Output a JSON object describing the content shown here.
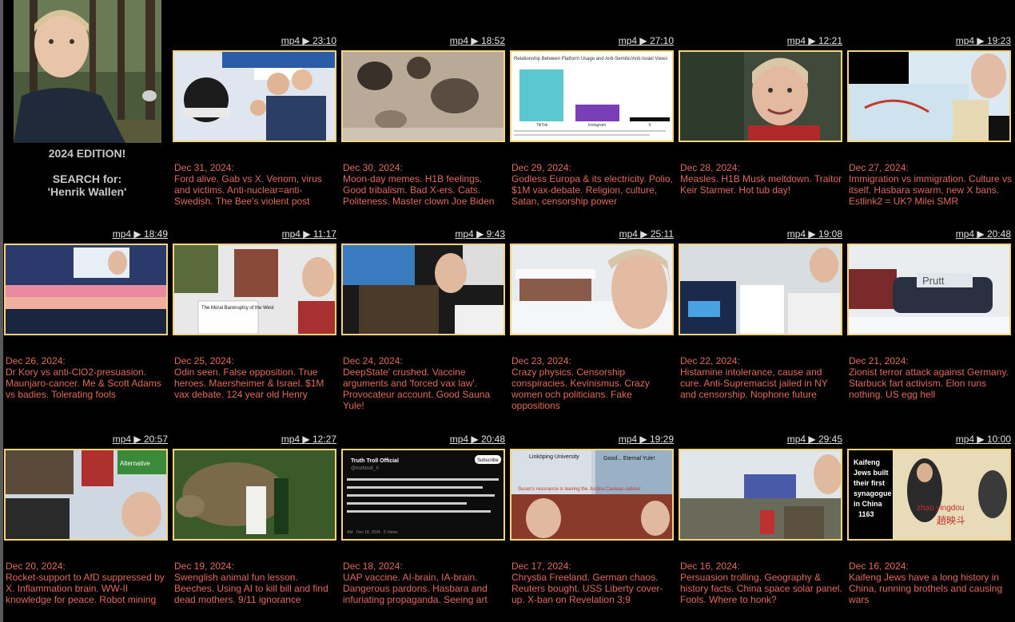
{
  "profile": {
    "edition": "2024 EDITION!",
    "search_line1": "SEARCH for:",
    "search_line2": "'Henrik Wallen'"
  },
  "videos": [
    {
      "mp4": "mp4 ▶ 23:10",
      "date": "Dec 31, 2024:",
      "desc": "Ford alive. Gab vs X. Venom, virus and victims. Anti-nuclear=anti-Swedish. The Bee's violent post"
    },
    {
      "mp4": "mp4 ▶ 18:52",
      "date": "Dec 30, 2024:",
      "desc": "Moon-day memes. H1B feelings. Good tribalism. Bad X-ers. Cats. Politeness. Master clown Joe Biden"
    },
    {
      "mp4": "mp4 ▶ 27:10",
      "date": "Dec 29, 2024:",
      "desc": "Godless Europa & its electricity. Polio, $1M vax-debate. Religion, culture, Satan, censorship power",
      "thumb_text": {
        "title": "Relationship Between Platform Usage and Anti-Semitic/Anti-Israel Views",
        "bars": [
          "TikTok",
          "Instagram",
          "X"
        ]
      }
    },
    {
      "mp4": "mp4 ▶ 12:21",
      "date": "Dec 28, 2024:",
      "desc": "Measles. H1B Musk meltdown. Traitor Keir Starmer. Hot tub day!"
    },
    {
      "mp4": "mp4 ▶ 19:23",
      "date": "Dec 27, 2024:",
      "desc": "Immigration vs immigration. Culture vs itself. Hasbara swarm, new X bans. Estlink2 = UK? Milei SMR"
    },
    {
      "mp4": "mp4 ▶ 18:49",
      "date": "Dec 26, 2024:",
      "desc": "Dr Kory vs anti-ClO2-presuasion. Maunjaro-cancer. Me & Scott Adams vs badies. Tolerating fools"
    },
    {
      "mp4": "mp4 ▶ 11:17",
      "date": "Dec 25, 2024:",
      "desc": "Odin seen. False opposition. True heroes. Maersheimer & Israel. $1M vax debate. 124 year old Henry",
      "thumb_text": {
        "caption": "The Moral Bankruptcy of the West"
      }
    },
    {
      "mp4": "mp4 ▶ 9:43",
      "date": "Dec 24, 2024:",
      "desc": "DeepState' crushed. Vaccine arguments and 'forced vax law'. Provocateur account. Good Sauna Yule!"
    },
    {
      "mp4": "mp4 ▶ 25:11",
      "date": "Dec 23, 2024:",
      "desc": "Crazy physics. Censorship conspiracies. Kevinismus. Crazy women och politicians. Fake oppositions"
    },
    {
      "mp4": "mp4 ▶ 19:08",
      "date": "Dec 22, 2024:",
      "desc": "Histamine intolerance, cause and cure. Anti-Supremacist jailed in NY and censorship. Nophone future"
    },
    {
      "mp4": "mp4 ▶ 20:48",
      "date": "Dec 21, 2024:",
      "desc": "Zionist terror attack against Germany. Starbuck fart activism. Elon runs nothing. US egg hell",
      "thumb_text": {
        "graffiti": "Prutt"
      }
    },
    {
      "mp4": "mp4 ▶ 20:57",
      "date": "Dec 20, 2024:",
      "desc": "Rocket-support to AfD suppressed by X. Inflammation brain. WW-II knowledge for peace. Robot mining",
      "thumb_text": {
        "badge": "Alternative"
      }
    },
    {
      "mp4": "mp4 ▶ 12:27",
      "date": "Dec 19, 2024:",
      "desc": "Swenglish animal fun lesson. Beeches. Using AI to kill bill and find dead mothers. 9/11 ignorance"
    },
    {
      "mp4": "mp4 ▶ 20:48",
      "date": "Dec 18, 2024:",
      "desc": "UAP vaccine. AI-brain, IA-brain. Dangerous pardons. Hasbara and infuriating propaganda. Seeing art",
      "thumb_text": {
        "account": "Truth Troll Official",
        "handle": "@truthtroll_X",
        "button": "Subscribe",
        "time": "AM · Dec 18, 2024 · 5 Views"
      }
    },
    {
      "mp4": "mp4 ▶ 19:29",
      "date": "Dec 17, 2024:",
      "desc": "Chrystia Freeland. German chaos. Reuters bought. USS Liberty cover-up. X-ban on Revelation 3;9",
      "thumb_text": {
        "left": "Linköping University",
        "right": "Good... Eternal Yule!",
        "middle": "Susan's resonance is leaving the Justina Casteau cabinet"
      }
    },
    {
      "mp4": "mp4 ▶ 29:45",
      "date": "Dec 16, 2024:",
      "desc": "Persuasion trolling. Geography & history facts. China space solar panel. Fools. Where to honk?"
    },
    {
      "mp4": "mp4 ▶ 10:00",
      "date": "Dec 16, 2024:",
      "desc": "Kaifeng Jews have a long history in China, running brothels and causing wars",
      "thumb_text": {
        "lines": [
          "Kaifeng",
          "Jews built",
          "their first",
          "synagogue",
          "in China",
          "1163"
        ],
        "name": "zhao yingdou",
        "chinese": "趙映斗"
      }
    }
  ]
}
